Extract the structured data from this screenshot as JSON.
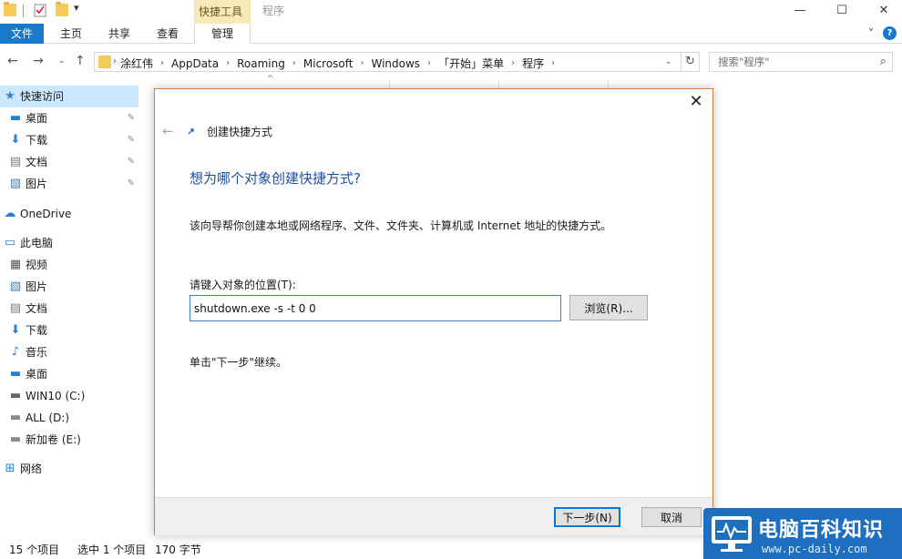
{
  "window": {
    "context_tab_group": "快捷工具",
    "title": "程序",
    "minimize_glyph": "—",
    "maximize_glyph": "☐",
    "close_glyph": "✕"
  },
  "ribbon": {
    "tabs": [
      "文件",
      "主页",
      "共享",
      "查看",
      "管理"
    ],
    "collapse_glyph": "˅",
    "help_glyph": "?"
  },
  "address": {
    "crumbs": [
      "涂红伟",
      "AppData",
      "Roaming",
      "Microsoft",
      "Windows",
      "「开始」菜单",
      "程序"
    ],
    "separator": "›",
    "search_placeholder": "搜索\"程序\""
  },
  "sidebar": {
    "items": [
      {
        "label": "快速访问",
        "icon": "star-icon"
      },
      {
        "label": "桌面",
        "icon": "desktop-icon",
        "pinned": true
      },
      {
        "label": "下载",
        "icon": "download-icon",
        "pinned": true
      },
      {
        "label": "文档",
        "icon": "document-icon",
        "pinned": true
      },
      {
        "label": "图片",
        "icon": "picture-icon",
        "pinned": true
      },
      {
        "label": "OneDrive",
        "icon": "cloud-icon"
      },
      {
        "label": "此电脑",
        "icon": "computer-icon"
      },
      {
        "label": "视频",
        "icon": "video-icon"
      },
      {
        "label": "图片",
        "icon": "picture-icon"
      },
      {
        "label": "文档",
        "icon": "document-icon"
      },
      {
        "label": "下载",
        "icon": "download-icon"
      },
      {
        "label": "音乐",
        "icon": "music-icon"
      },
      {
        "label": "桌面",
        "icon": "desktop-icon"
      },
      {
        "label": "WIN10 (C:)",
        "icon": "drive-c-icon"
      },
      {
        "label": "ALL (D:)",
        "icon": "drive-icon"
      },
      {
        "label": "新加卷 (E:)",
        "icon": "drive-icon"
      },
      {
        "label": "网络",
        "icon": "network-icon"
      }
    ]
  },
  "status": {
    "item_count": "15 个项目",
    "selected": "选中 1 个项目",
    "size": "170 字节"
  },
  "dialog": {
    "header": "创建快捷方式",
    "question": "想为哪个对象创建快捷方式?",
    "description": "该向导帮你创建本地或网络程序、文件、文件夹、计算机或 Internet 地址的快捷方式。",
    "location_label": "请键入对象的位置(T):",
    "location_value": "shutdown.exe -s -t 0 0",
    "browse_label": "浏览(R)...",
    "hint": "单击\"下一步\"继续。",
    "next_label": "下一步(N)",
    "cancel_label": "取消",
    "close_glyph": "✕",
    "back_glyph": "←"
  },
  "watermark": {
    "title": "电脑百科知识",
    "url": "www.pc-daily.com"
  }
}
